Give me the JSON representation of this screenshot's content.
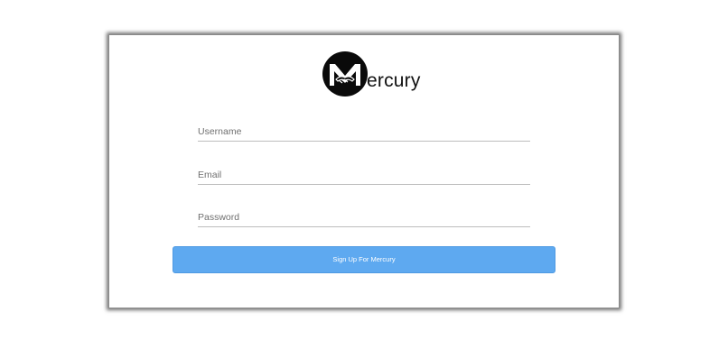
{
  "brand": {
    "name_suffix": "ercury",
    "logo_icon": "mercury-handshake-logo-icon"
  },
  "form": {
    "username_placeholder": "Username",
    "email_placeholder": "Email",
    "password_placeholder": "Password",
    "submit_label": "Sign Up For Mercury"
  },
  "colors": {
    "button": "#5ea9f0",
    "logo_circle": "#0a0a0a",
    "underline": "#bdbdbd"
  }
}
